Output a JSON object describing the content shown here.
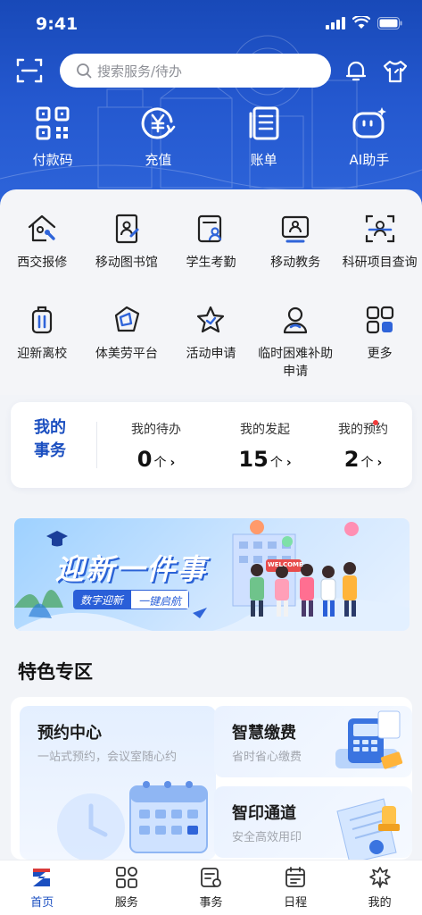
{
  "status": {
    "time": "9:41"
  },
  "search": {
    "placeholder": "搜索服务/待办"
  },
  "quick_actions": [
    {
      "label": "付款码",
      "icon": "qr-code-icon"
    },
    {
      "label": "充值",
      "icon": "yen-recharge-icon"
    },
    {
      "label": "账单",
      "icon": "bill-icon"
    },
    {
      "label": "AI助手",
      "icon": "ai-assistant-icon"
    }
  ],
  "services": [
    {
      "label": "西交报修",
      "icon": "house-repair-icon"
    },
    {
      "label": "移动图书馆",
      "icon": "library-icon"
    },
    {
      "label": "学生考勤",
      "icon": "attendance-icon"
    },
    {
      "label": "移动教务",
      "icon": "academic-icon"
    },
    {
      "label": "科研项目查询",
      "icon": "research-scan-icon"
    },
    {
      "label": "迎新离校",
      "icon": "luggage-icon"
    },
    {
      "label": "体美劳平台",
      "icon": "diamond-icon"
    },
    {
      "label": "活动申请",
      "icon": "star-icon"
    },
    {
      "label": "临时困难补助申请",
      "icon": "aid-icon"
    },
    {
      "label": "更多",
      "icon": "grid-more-icon"
    }
  ],
  "affairs": {
    "title_line1": "我的",
    "title_line2": "事务",
    "items": [
      {
        "label": "我的待办",
        "count": "0",
        "unit": "个"
      },
      {
        "label": "我的发起",
        "count": "15",
        "unit": "个"
      },
      {
        "label": "我的预约",
        "count": "2",
        "unit": "个",
        "has_dot": true
      }
    ]
  },
  "banner": {
    "title": "迎新一件事",
    "tag_a": "数字迎新",
    "tag_b": "一键启航",
    "sign": "WELCOME"
  },
  "featured": {
    "title": "特色专区",
    "items": [
      {
        "title": "预约中心",
        "subtitle": "一站式预约，会议室随心约"
      },
      {
        "title": "智慧缴费",
        "subtitle": "省时省心缴费"
      },
      {
        "title": "智印通道",
        "subtitle": "安全高效用印"
      }
    ]
  },
  "tabs": [
    {
      "label": "首页",
      "icon": "home-icon",
      "active": true
    },
    {
      "label": "服务",
      "icon": "services-icon",
      "active": false
    },
    {
      "label": "事务",
      "icon": "affairs-icon",
      "active": false
    },
    {
      "label": "日程",
      "icon": "calendar-icon",
      "active": false
    },
    {
      "label": "我的",
      "icon": "profile-icon",
      "active": false
    }
  ],
  "colors": {
    "primary": "#1b4fc0",
    "header_top": "#1849b8",
    "badge": "#f03a3a"
  }
}
